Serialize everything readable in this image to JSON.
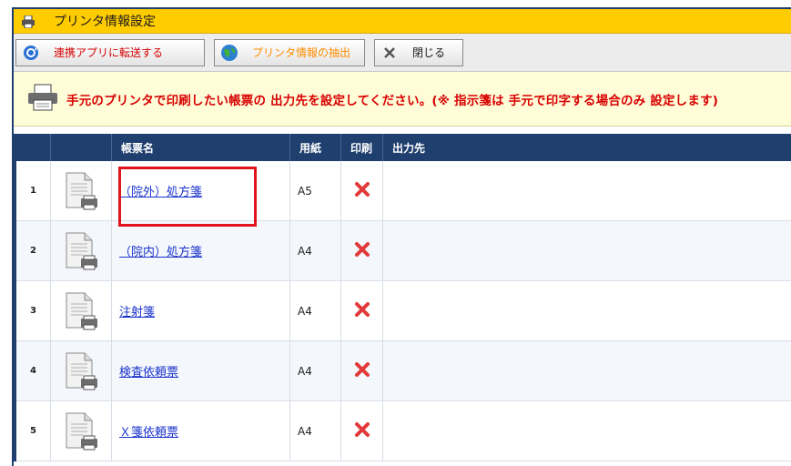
{
  "window": {
    "title": "プリンタ情報設定"
  },
  "toolbar": {
    "transfer_label": "連携アプリに転送する",
    "extract_label": "プリンタ情報の抽出",
    "close_label": "閉じる"
  },
  "notice": {
    "text": "手元のプリンタで印刷したい帳票の 出力先を設定してください。(※ 指示箋は 手元で印字する場合のみ 設定します)"
  },
  "table": {
    "columns": [
      "",
      "",
      "帳票名",
      "用紙",
      "印刷",
      "出力先"
    ],
    "rows": [
      {
        "no": "1",
        "name": "（院外）処方箋",
        "paper": "A5",
        "print": "x-mark-icon",
        "output": ""
      },
      {
        "no": "2",
        "name": "（院内）処方箋",
        "paper": "A4",
        "print": "x-mark-icon",
        "output": ""
      },
      {
        "no": "3",
        "name": "注射箋",
        "paper": "A4",
        "print": "x-mark-icon",
        "output": ""
      },
      {
        "no": "4",
        "name": "検査依頼票",
        "paper": "A4",
        "print": "x-mark-icon",
        "output": ""
      },
      {
        "no": "5",
        "name": "Ｘ箋依頼票",
        "paper": "A4",
        "print": "x-mark-icon",
        "output": ""
      }
    ]
  },
  "colors": {
    "title_bar": "#ffcc00",
    "header": "#1f3f6e",
    "notice_text": "#d80000",
    "highlight": "#e0141e"
  }
}
